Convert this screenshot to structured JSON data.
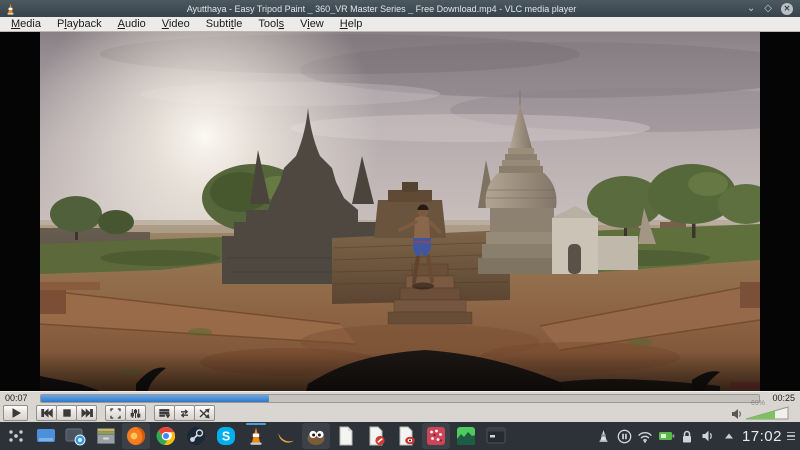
{
  "window": {
    "title": "Ayutthaya - Easy Tripod Paint _ 360_VR Master Series _ Free Download.mp4 - VLC media player",
    "controls": [
      "minimize",
      "maximize",
      "close"
    ]
  },
  "menubar": {
    "items": [
      {
        "label": "Media",
        "mnemonic": 0
      },
      {
        "label": "Playback",
        "mnemonic": 1
      },
      {
        "label": "Audio",
        "mnemonic": 0
      },
      {
        "label": "Video",
        "mnemonic": 0
      },
      {
        "label": "Subtitle",
        "mnemonic": 5
      },
      {
        "label": "Tools",
        "mnemonic": 4
      },
      {
        "label": "View",
        "mnemonic": 1
      },
      {
        "label": "Help",
        "mnemonic": 0
      }
    ]
  },
  "transport": {
    "elapsed": "00:07",
    "duration": "00:25",
    "progress_percent": 31.7
  },
  "player_controls": {
    "buttons": [
      "play",
      "previous",
      "stop",
      "next",
      "fullscreen",
      "extended-settings",
      "playlist",
      "loop",
      "random"
    ],
    "volume": {
      "percent_label": "69%",
      "level_percent": 69
    }
  },
  "taskbar": {
    "apps": [
      {
        "name": "app-launcher"
      },
      {
        "name": "window-manager"
      },
      {
        "name": "screenshot-tool"
      },
      {
        "name": "file-cabinet"
      },
      {
        "name": "firefox",
        "highlighted": true
      },
      {
        "name": "chrome"
      },
      {
        "name": "steam"
      },
      {
        "name": "skype"
      },
      {
        "name": "vlc",
        "active": true
      },
      {
        "name": "crescent-app"
      },
      {
        "name": "gimp",
        "highlighted": true
      },
      {
        "name": "text-document"
      },
      {
        "name": "document-edit"
      },
      {
        "name": "document-viewer"
      },
      {
        "name": "pattern-tool",
        "highlighted": true
      },
      {
        "name": "audio-wave-app"
      },
      {
        "name": "terminal"
      }
    ],
    "tray": [
      "vlc-tray",
      "media-pause",
      "wifi",
      "battery",
      "lock",
      "audio",
      "caret-up"
    ],
    "clock": "17:02"
  }
}
